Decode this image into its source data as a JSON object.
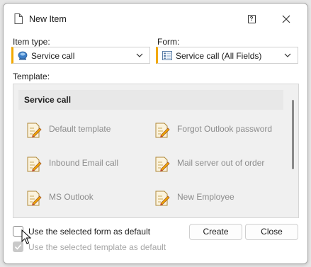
{
  "window": {
    "title": "New Item",
    "help_glyph": "?",
    "icons": {
      "document": "document-icon",
      "help": "help-icon",
      "close": "close-icon"
    }
  },
  "item_type": {
    "label": "Item type:",
    "value": "Service call",
    "icon": "service-call-icon"
  },
  "form": {
    "label": "Form:",
    "value": "Service call (All Fields)",
    "icon": "form-icon"
  },
  "template": {
    "label": "Template:",
    "group_title": "Service call",
    "items": [
      {
        "label": "Default template",
        "icon": "template-icon"
      },
      {
        "label": "Forgot Outlook password",
        "icon": "template-icon"
      },
      {
        "label": "Inbound Email call",
        "icon": "template-icon"
      },
      {
        "label": "Mail server out of order",
        "icon": "template-icon"
      },
      {
        "label": "MS Outlook",
        "icon": "template-icon"
      },
      {
        "label": "New Employee",
        "icon": "template-icon"
      }
    ]
  },
  "options": {
    "form_default_label": "Use the selected form as default",
    "form_default_checked": false,
    "template_default_label": "Use the selected template as default",
    "template_default_checked": true,
    "template_default_enabled": false
  },
  "buttons": {
    "create": "Create",
    "close": "Close"
  },
  "colors": {
    "accent": "#f2a900",
    "disabled_text": "#a6a6a6",
    "item_text": "#8c8c8c"
  }
}
